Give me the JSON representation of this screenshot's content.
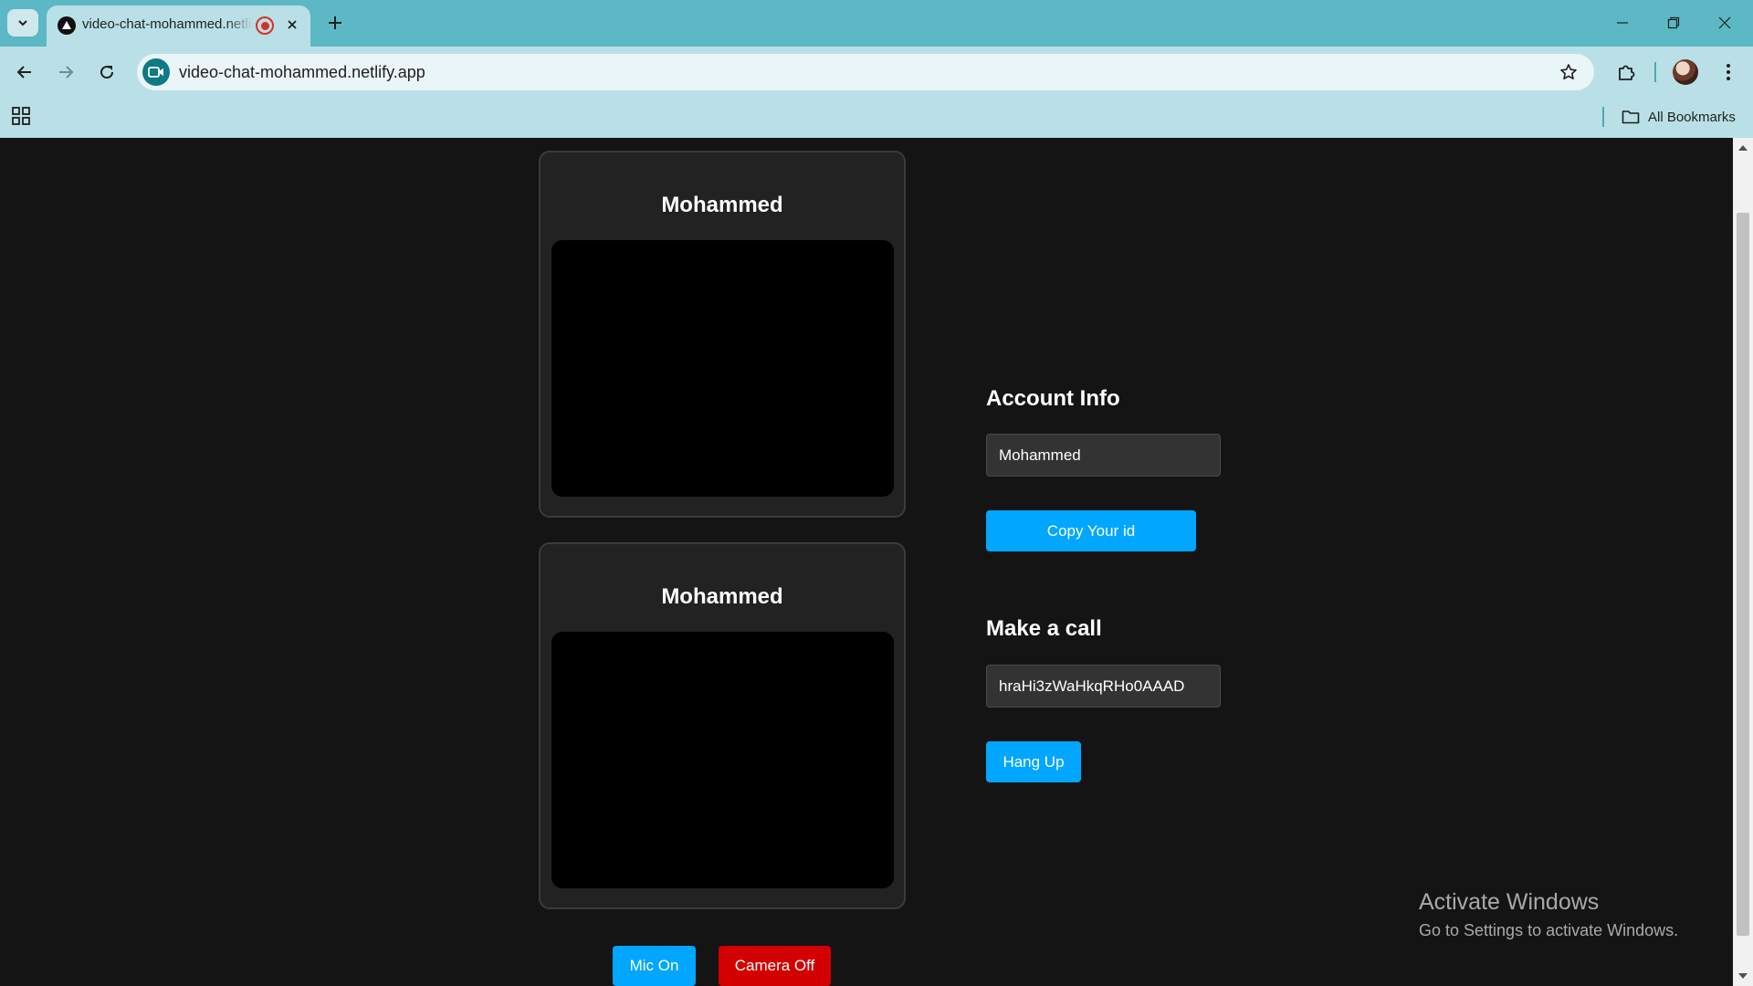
{
  "browser": {
    "tab": {
      "title": "video-chat-mohammed.netlify.app"
    },
    "address_bar": {
      "url": "video-chat-mohammed.netlify.app"
    },
    "bookmarks_bar": {
      "all_bookmarks_label": "All Bookmarks"
    }
  },
  "app": {
    "local_video": {
      "name": "Mohammed"
    },
    "remote_video": {
      "name": "Mohammed"
    },
    "account_info": {
      "title": "Account Info",
      "name_value": "Mohammed",
      "copy_id_label": "Copy Your id"
    },
    "make_call": {
      "title": "Make a call",
      "peer_id_value": "hraHi3zWaHkqRHo0AAAD",
      "hang_up_label": "Hang Up"
    },
    "controls": {
      "mic_label": "Mic On",
      "camera_label": "Camera Off"
    },
    "colors": {
      "primary_button": "#00a6ff",
      "danger_button": "#d30000",
      "page_background": "#141414",
      "card_background": "#222222"
    }
  },
  "os_overlay": {
    "activate_title": "Activate Windows",
    "activate_subtitle": "Go to Settings to activate Windows."
  }
}
